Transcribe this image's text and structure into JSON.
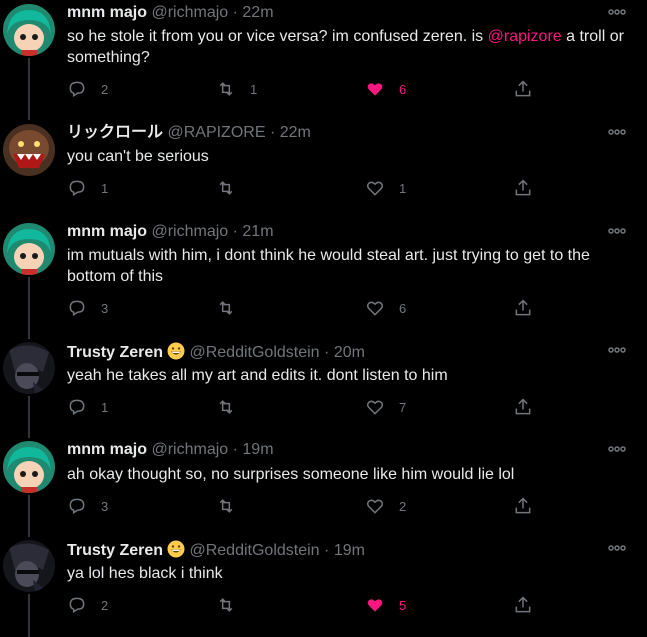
{
  "tweets": [
    {
      "name": "mnm majo",
      "handle": "@richmajo",
      "dot": "·",
      "time": "22m",
      "text_before": "so he stole it from you or vice versa? im confused zeren. is ",
      "mention": "@rapizore",
      "text_after": " a troll or something?",
      "avatar": "bulma",
      "emoji": "",
      "replies": "2",
      "retweets": "1",
      "likes": "6",
      "liked": true
    },
    {
      "name": "リックロール",
      "handle": "@RAPIZORE",
      "dot": "·",
      "time": "22m",
      "text": "you can't be serious",
      "avatar": "creature",
      "emoji": "",
      "replies": "1",
      "retweets": "",
      "likes": "1",
      "liked": false
    },
    {
      "name": "mnm majo",
      "handle": "@richmajo",
      "dot": "·",
      "time": "21m",
      "text": "im mutuals with him, i dont think he would steal art. just trying to get to the bottom of this",
      "avatar": "bulma",
      "emoji": "",
      "replies": "3",
      "retweets": "",
      "likes": "6",
      "liked": false
    },
    {
      "name": "Trusty Zeren",
      "handle": "@RedditGoldstein",
      "dot": "·",
      "time": "20m",
      "text": "yeah he takes all my art and edits it. dont listen to him",
      "avatar": "dark",
      "emoji": "grinning-face",
      "replies": "1",
      "retweets": "",
      "likes": "7",
      "liked": false
    },
    {
      "name": "mnm majo",
      "handle": "@richmajo",
      "dot": "·",
      "time": "19m",
      "text": "ah okay thought so, no surprises someone like him would lie lol",
      "avatar": "bulma",
      "emoji": "",
      "replies": "3",
      "retweets": "",
      "likes": "2",
      "liked": false
    },
    {
      "name": "Trusty Zeren",
      "handle": "@RedditGoldstein",
      "dot": "·",
      "time": "19m",
      "text": "ya lol hes black i think",
      "avatar": "dark",
      "emoji": "grinning-face",
      "replies": "2",
      "retweets": "",
      "likes": "5",
      "liked": true
    }
  ],
  "colors": {
    "background": "#000000",
    "text": "#e7e9ea",
    "muted": "#71767b",
    "like_active": "#f91880",
    "mention": "#f91880"
  }
}
